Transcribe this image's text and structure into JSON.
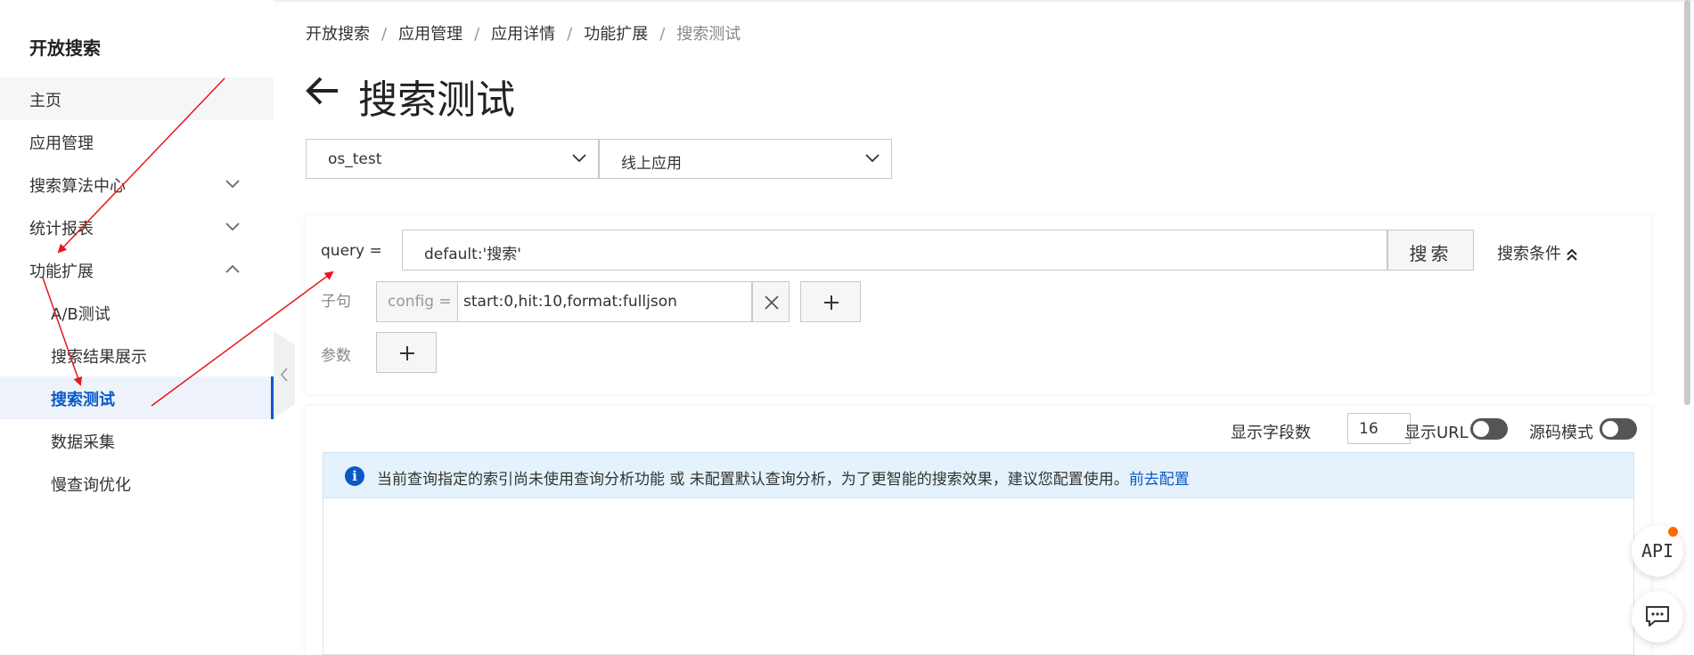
{
  "sidebar": {
    "brand": "开放搜索",
    "items": [
      {
        "label": "主页"
      },
      {
        "label": "应用管理"
      },
      {
        "label": "搜索算法中心"
      },
      {
        "label": "统计报表"
      },
      {
        "label": "功能扩展"
      },
      {
        "label": "A/B测试"
      },
      {
        "label": "搜索结果展示"
      },
      {
        "label": "搜索测试"
      },
      {
        "label": "数据采集"
      },
      {
        "label": "慢查询优化"
      }
    ]
  },
  "breadcrumb": [
    "开放搜索",
    "应用管理",
    "应用详情",
    "功能扩展",
    "搜索测试"
  ],
  "page": {
    "title": "搜索测试"
  },
  "selects": {
    "app": "os_test",
    "version": "线上应用"
  },
  "query": {
    "label": "query =",
    "value": "default:'搜索'",
    "search_button": "搜索",
    "conditions_label": "搜索条件"
  },
  "clause": {
    "label": "子句",
    "config_prefix": "config =",
    "config_value": "start:0,hit:10,format:fulljson"
  },
  "params": {
    "label": "参数"
  },
  "results": {
    "field_count_label": "显示字段数",
    "field_count_value": "16",
    "show_url_label": "显示URL",
    "source_mode_label": "源码模式",
    "alert_text": "当前查询指定的索引尚未使用查询分析功能 或 未配置默认查询分析，为了更智能的搜索效果，建议您配置使用。",
    "alert_link": "前去配置"
  },
  "floating": {
    "api_label": "API"
  },
  "colors": {
    "accent": "#0a59c7",
    "annotation_arrow": "#e8161b",
    "notify_dot": "#ff6a00"
  }
}
